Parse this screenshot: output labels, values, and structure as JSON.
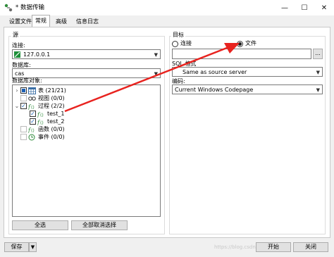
{
  "window": {
    "title": "* 数据传输",
    "minimize": "—",
    "maximize": "☐",
    "close": "✕"
  },
  "tabs": [
    "设置文件",
    "常规",
    "高级",
    "信息日志"
  ],
  "source": {
    "group_label": "源",
    "connection_label": "连接:",
    "connection_value": "127.0.0.1",
    "database_label": "数据库:",
    "database_value": "cas",
    "objects_label": "数据库对象:",
    "tree": [
      {
        "label": "表  (21/21)",
        "expander": "›",
        "check": "partial",
        "icon": "table-icon",
        "indent": 0
      },
      {
        "label": "视图  (0/0)",
        "expander": "",
        "check": "unchecked-disabled",
        "icon": "view-icon",
        "indent": 0
      },
      {
        "label": "过程  (2/2)",
        "expander": "⌄",
        "check": "checked",
        "icon": "procedure-icon",
        "indent": 0
      },
      {
        "label": "test_1",
        "expander": "",
        "check": "checked",
        "icon": "function-icon",
        "indent": 1
      },
      {
        "label": "test_2",
        "expander": "",
        "check": "checked",
        "icon": "function-icon",
        "indent": 1
      },
      {
        "label": "函数  (0/0)",
        "expander": "",
        "check": "unchecked-disabled",
        "icon": "function-icon",
        "indent": 0
      },
      {
        "label": "事件  (0/0)",
        "expander": "",
        "check": "unchecked-disabled",
        "icon": "event-icon",
        "indent": 0
      }
    ],
    "select_all": "全选",
    "deselect_all": "全部取消选择"
  },
  "target": {
    "group_label": "目标",
    "radio_connection": "连接",
    "radio_file": "文件",
    "selected": "文件",
    "file_path": "",
    "browse_label": "...",
    "sql_format_label": "SQL 格式",
    "sql_format_value": "Same as source server",
    "encoding_label": "编码:",
    "encoding_value": "Current Windows Codepage"
  },
  "bottom": {
    "save": "保存",
    "start": "开始",
    "close": "关闭",
    "watermark": "https://blog.csdn.net/qq_39..."
  },
  "colors": {
    "arrow": "#e8231f",
    "accent": "#1a5fb4"
  }
}
